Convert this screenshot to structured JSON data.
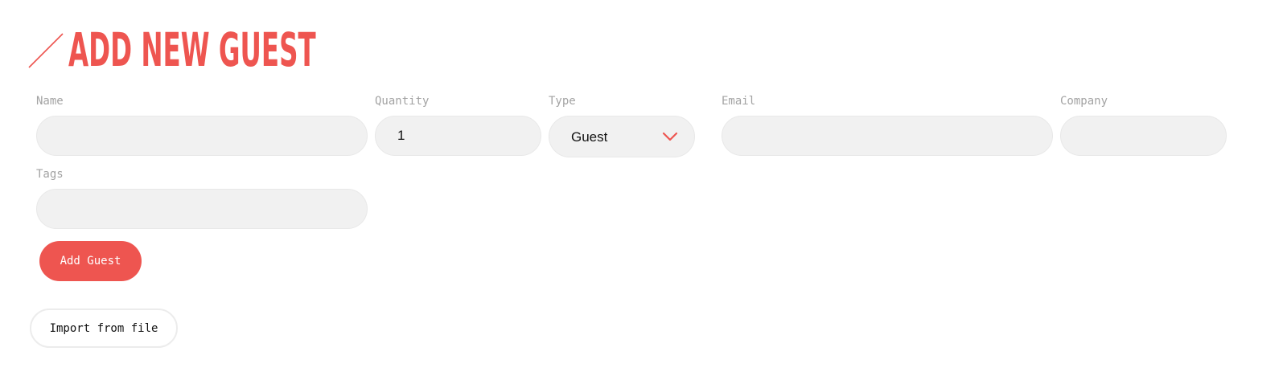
{
  "page": {
    "title": "ADD NEW GUEST",
    "accent_color": "#ee5550",
    "title_icon": "slash-icon"
  },
  "form": {
    "name": {
      "label": "Name",
      "value": ""
    },
    "quantity": {
      "label": "Quantity",
      "value": "1"
    },
    "type": {
      "label": "Type",
      "value": "Guest",
      "icon": "chevron-down-icon"
    },
    "email": {
      "label": "Email",
      "value": ""
    },
    "company": {
      "label": "Company",
      "value": ""
    },
    "tags": {
      "label": "Tags",
      "value": ""
    }
  },
  "actions": {
    "add_label": "Add Guest",
    "import_label": "Import from file"
  }
}
